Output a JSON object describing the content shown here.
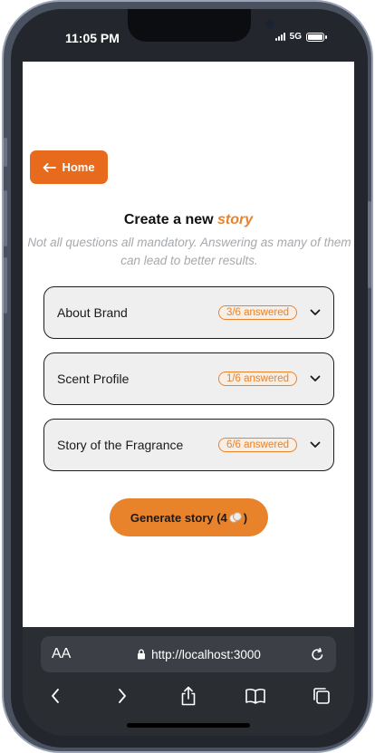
{
  "status_bar": {
    "time": "11:05 PM",
    "network": "5G"
  },
  "header": {
    "home_label": "Home",
    "title_prefix": "Create a new",
    "title_accent": "story",
    "subtitle": "Not all questions all mandatory. Answering as many of them can lead to better results."
  },
  "sections": [
    {
      "label": "About Brand",
      "badge": "3/6 answered"
    },
    {
      "label": "Scent Profile",
      "badge": "1/6 answered"
    },
    {
      "label": "Story of the Fragrance",
      "badge": "6/6 answered"
    }
  ],
  "generate": {
    "label_prefix": "Generate story (4",
    "label_suffix": ")"
  },
  "browser": {
    "text_size_label": "AA",
    "url": "http://localhost:3000"
  },
  "colors": {
    "accent": "#e8832c",
    "home_button": "#e86a1c",
    "chrome": "#2a2d32"
  }
}
